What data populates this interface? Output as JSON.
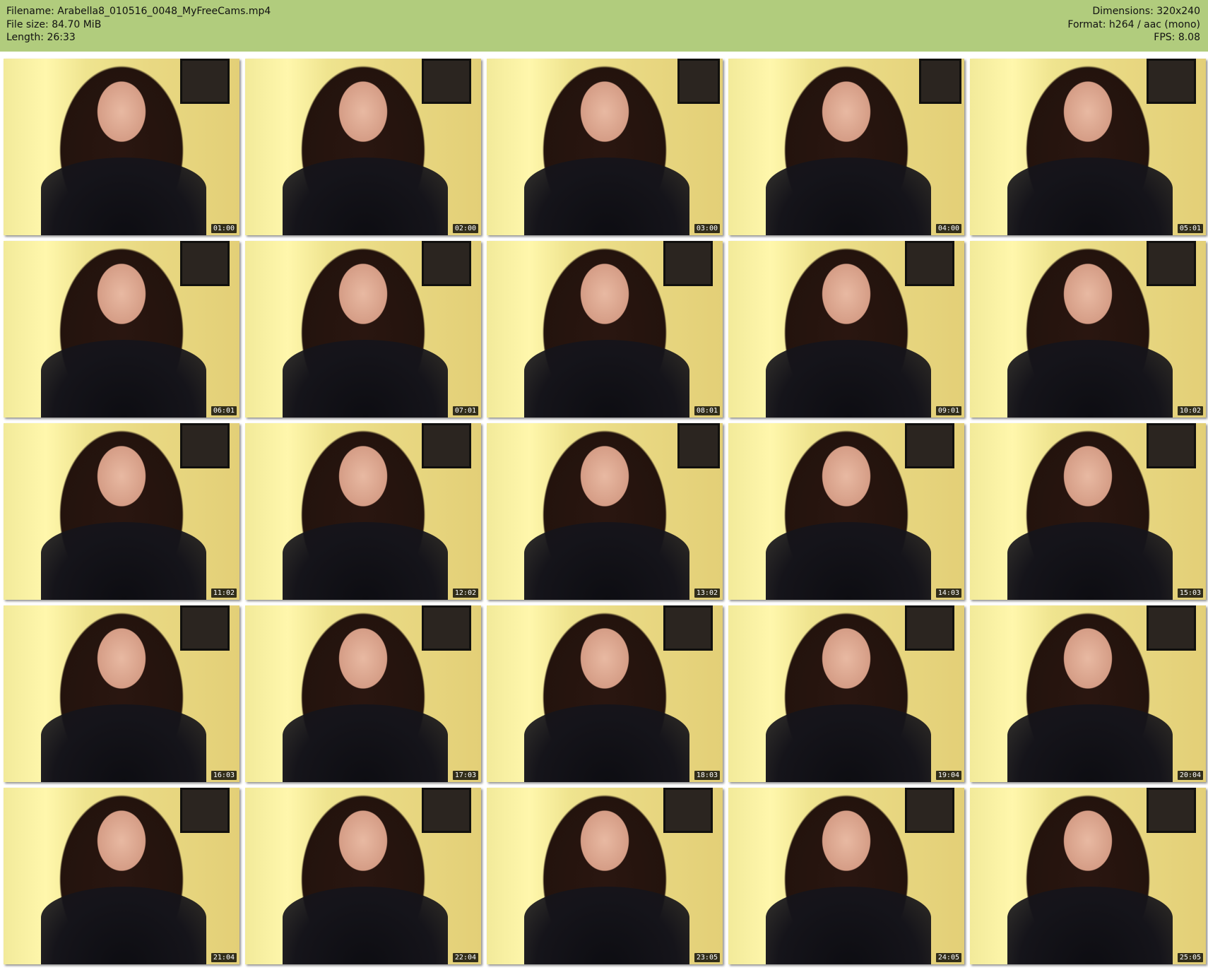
{
  "info": {
    "filename": "Filename: Arabella8_010516_0048_MyFreeCams.mp4",
    "filesize": "File size: 84.70 MiB",
    "length": "Length: 26:33",
    "dimensions": "Dimensions: 320x240",
    "format": "Format: h264 / aac (mono)",
    "fps": "FPS: 8.08"
  },
  "thumbnails": [
    {
      "time": "01:00"
    },
    {
      "time": "02:00"
    },
    {
      "time": "03:00"
    },
    {
      "time": "04:00"
    },
    {
      "time": "05:01"
    },
    {
      "time": "06:01"
    },
    {
      "time": "07:01"
    },
    {
      "time": "08:01"
    },
    {
      "time": "09:01"
    },
    {
      "time": "10:02"
    },
    {
      "time": "11:02"
    },
    {
      "time": "12:02"
    },
    {
      "time": "13:02"
    },
    {
      "time": "14:03"
    },
    {
      "time": "15:03"
    },
    {
      "time": "16:03"
    },
    {
      "time": "17:03"
    },
    {
      "time": "18:03"
    },
    {
      "time": "19:04"
    },
    {
      "time": "20:04"
    },
    {
      "time": "21:04"
    },
    {
      "time": "22:04"
    },
    {
      "time": "23:05"
    },
    {
      "time": "24:05"
    },
    {
      "time": "25:05"
    }
  ]
}
